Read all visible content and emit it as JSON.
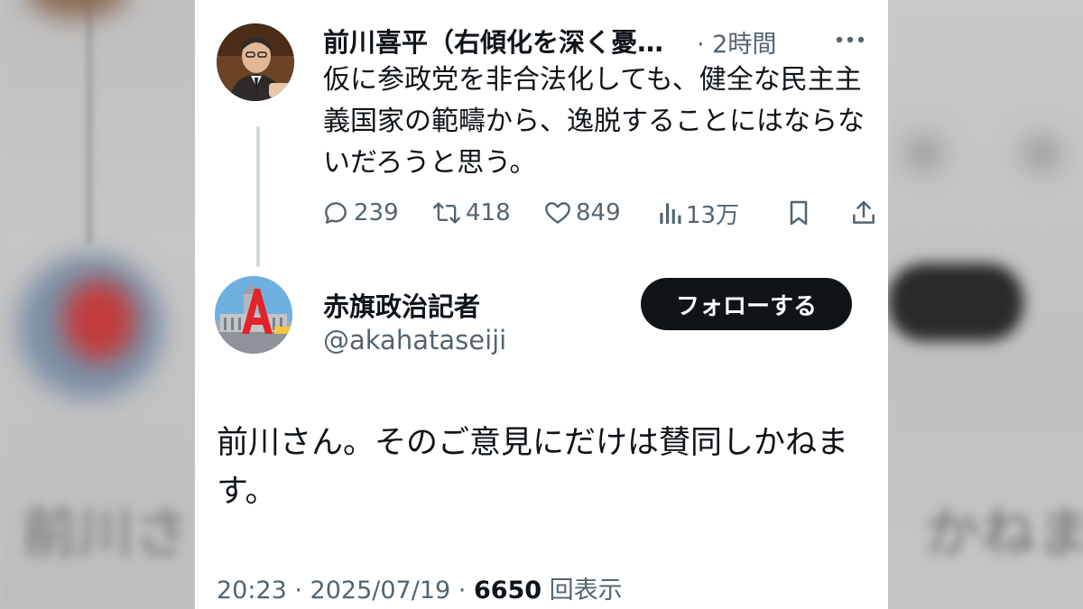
{
  "quoted_tweet": {
    "author_name": "前川喜平（右傾化を深く憂…",
    "time_ago": "· 2時間",
    "text": "仮に参政党を非合法化しても、健全な民主主義国家の範疇から、逸脱することにはならないだろうと思う。",
    "stats": {
      "replies": "239",
      "retweets": "418",
      "likes": "849",
      "views": "13万"
    }
  },
  "main_tweet": {
    "author_name": "赤旗政治記者",
    "handle": "@akahataseiji",
    "follow_label": "フォローする",
    "text": "前川さん。そのご意見にだけは賛同しかねます。",
    "time": "20:23 · 2025/07/19 · ",
    "views_count": "6650",
    "views_label": " 回表示"
  },
  "icons": {
    "more": "more-icon",
    "reply": "reply-icon",
    "retweet": "retweet-icon",
    "like": "heart-icon",
    "views": "views-icon",
    "bookmark": "bookmark-icon",
    "share": "share-icon"
  },
  "colors": {
    "text_primary": "#0f1419",
    "text_secondary": "#536471",
    "thread_line": "#cfd9de",
    "follow_button_bg": "#0f1419"
  }
}
